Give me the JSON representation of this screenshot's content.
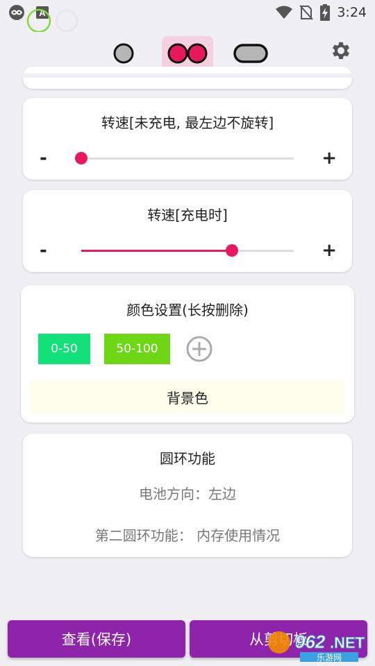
{
  "status_bar": {
    "time": "3:24",
    "icons": [
      "infinity-icon",
      "accessibility-a-icon",
      "ring-icon",
      "wifi-icon",
      "no-sim-icon",
      "battery-charging-icon"
    ]
  },
  "top_modes": {
    "items": [
      {
        "name": "single-circle-mode"
      },
      {
        "name": "double-circle-mode",
        "active": true
      },
      {
        "name": "pill-mode"
      }
    ],
    "accent_active_bg": "#f5d0de",
    "icon_fill": "#e8185d"
  },
  "speed_uncharged": {
    "title": "转速[未充电, 最左边不旋转]",
    "minus": "-",
    "plus": "+",
    "value_fraction": 0.0
  },
  "speed_charging": {
    "title": "转速[充电时]",
    "minus": "-",
    "plus": "+",
    "value_fraction": 0.71
  },
  "color_settings": {
    "title": "颜色设置(长按删除)",
    "chips": [
      {
        "label": "0-50",
        "color": "#12e078"
      },
      {
        "label": "50-100",
        "color": "#6ed614"
      }
    ],
    "background_label": "背景色",
    "background_color": "#fffdeb"
  },
  "ring_function": {
    "title": "圆环功能",
    "battery_direction": "电池方向：左边",
    "second_ring": "第二圆环功能： 内存使用情况"
  },
  "bottom": {
    "view_save": "查看(保存)",
    "from_clipboard": "从剪切板",
    "accent": "#8e24aa"
  },
  "watermark": {
    "brand": "962",
    "suffix": ".NET",
    "sub": "乐游网"
  }
}
